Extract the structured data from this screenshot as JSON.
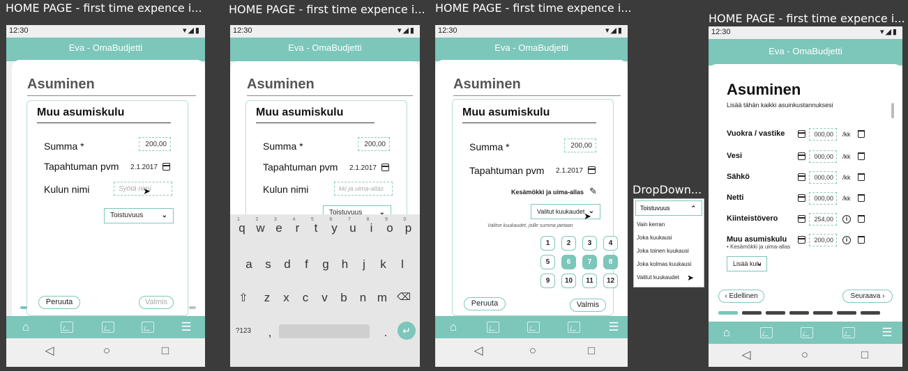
{
  "frames": [
    {
      "title": "HOME PAGE - first time expence i..."
    },
    {
      "title": "HOME PAGE - first time expence i..."
    },
    {
      "title": "HOME PAGE - first time expence i..."
    },
    {
      "title": "DropDown..."
    },
    {
      "title": "HOME PAGE - first time expence i..."
    }
  ],
  "status": {
    "time": "12:30",
    "icons": "▾◢▮"
  },
  "app": {
    "title": "Eva - OmaBudjetti"
  },
  "form": {
    "heading": "Asuminen",
    "card_title": "Muu asumiskulu",
    "sum_label": "Summa *",
    "sum_value": "200,00",
    "date_label": "Tapahtuman pvm",
    "date_value": "2.1.2017",
    "name_label": "Kulun nimi",
    "name_placeholder": "Syötä nimi",
    "name_typing": "kki ja uima-allas",
    "name_saved": "Kesämökki ja uima-allas",
    "frequency": "Toistuvuus",
    "selected_months": "Valitut kuukaudet",
    "months_hint": "Valitse kuukaudet, joille summa jaetaan",
    "cancel": "Peruuta",
    "done": "Valmis"
  },
  "months": [
    {
      "n": "1",
      "sel": false
    },
    {
      "n": "2",
      "sel": false
    },
    {
      "n": "3",
      "sel": false
    },
    {
      "n": "4",
      "sel": false
    },
    {
      "n": "5",
      "sel": false
    },
    {
      "n": "6",
      "sel": true
    },
    {
      "n": "7",
      "sel": true
    },
    {
      "n": "8",
      "sel": true
    },
    {
      "n": "9",
      "sel": false
    },
    {
      "n": "10",
      "sel": false
    },
    {
      "n": "11",
      "sel": false
    },
    {
      "n": "12",
      "sel": false
    }
  ],
  "keyboard": {
    "row1": [
      "q",
      "w",
      "e",
      "r",
      "t",
      "y",
      "u",
      "i",
      "o",
      "p"
    ],
    "hints": [
      "1",
      "2",
      "3",
      "4",
      "5",
      "6",
      "7",
      "8",
      "9",
      "0"
    ],
    "row2": [
      "a",
      "s",
      "d",
      "f",
      "g",
      "h",
      "j",
      "k",
      "l"
    ],
    "row3": [
      "z",
      "x",
      "c",
      "v",
      "b",
      "n",
      "m"
    ],
    "symbols": "?123",
    "comma": ",",
    "period": "."
  },
  "dropdown": {
    "head": "Toistuvuus",
    "options": [
      "Vain kerran",
      "Joka kuukausi",
      "Joka toinen kuukausi",
      "Joka kolmas kuukausi",
      "Valitut kuukaudet"
    ]
  },
  "overview": {
    "heading": "Asuminen",
    "subtitle": "Lisää tähän kaikki asuinkustannuksesi",
    "per_month": "/kk",
    "rows": [
      {
        "label": "Vuokra / vastike",
        "value": "000,00",
        "kind": "monthly"
      },
      {
        "label": "Vesi",
        "value": "000,00",
        "kind": "monthly"
      },
      {
        "label": "Sähkö",
        "value": "000,00",
        "kind": "monthly"
      },
      {
        "label": "Netti",
        "value": "000,00",
        "kind": "monthly"
      },
      {
        "label": "Kiinteistövero",
        "value": "254,00",
        "kind": "info"
      },
      {
        "label": "Muu asumiskulu",
        "value": "200,00",
        "kind": "info",
        "sub": "• Kesämökki ja uima-allas"
      }
    ],
    "add": "Lisää kulu",
    "prev": "Edellinen",
    "next": "Seuraava"
  }
}
